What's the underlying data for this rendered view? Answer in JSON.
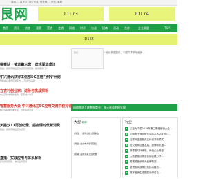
{
  "topbar": {
    "text": "| 接收..., 留言中, 办公室桌, 刊登稿..., 开放, 客服"
  },
  "logo": {
    "text": "艮网"
  },
  "ads": {
    "left": "ID173",
    "right": "ID174",
    "banner": "ID165"
  },
  "nav": [
    "首页",
    "资讯",
    "热点",
    "观察",
    "营销",
    "会销",
    "网络",
    "时评",
    "访谈",
    "招商",
    "活动",
    "合作",
    "企业联盟",
    "TOP"
  ],
  "thumb": {
    "placeholder": "封面",
    "caption": "一组经典图整件，中国共享单车营销..."
  },
  "news": [
    {
      "title": "换乘队 · 被动蓄水营，双轮驱动成长",
      "sub": "别是，别样营销加密的经营高端营销，新闻服务门户"
    },
    {
      "title": "中兴通讯获得工信部5G应用\"扬帆\"计划",
      "sub": "创新中兴通讯应用实力，打造优秀品牌"
    },
    {
      "title": "在农村创业家：进阶与挑战探析",
      "sub": "未来农村市场新格局，探索城乡协同"
    },
    {
      "title": "智慧服务大会 中兴通讯在5G应用交流中获好评",
      "sub": "数字化赋能智能生活，创新驱动发展"
    }
  ],
  "green_bar": {
    "text": "网络物流互联数据商业：多元化盈利模式探"
  },
  "lower_left": [
    {
      "title": "天猫双11再创纪录，后疫情时代新消费",
      "sub": "别是，别样营销加密的经营"
    },
    {
      "title": "直播：实践应用与体系解析",
      "sub": "打造智慧营销，做好品牌营销"
    }
  ],
  "panel_left": {
    "title": "大型",
    "tag": "新闻",
    "items": [
      "[财经] 一组商业模式观察全",
      "[网络] 社交电商新营销论",
      "[营销] 品牌营销之道文章"
    ]
  },
  "panel_right": {
    "title": "行业",
    "items": [
      "正在为中国2019年第二季度营销大会...",
      "中国电子商务研究中心发布2019年...",
      "互联网金融服务实体经济新模式...",
      "社交电商加速发展，品牌新机遇...",
      "新零售时代来临，传统企业转型...",
      "大数据驱动精准营销实践分享...",
      "短视频营销成为品牌新宠...",
      "跨境电商政策红利持续释放...",
      "数字营销生态圈建设研讨会..."
    ]
  }
}
